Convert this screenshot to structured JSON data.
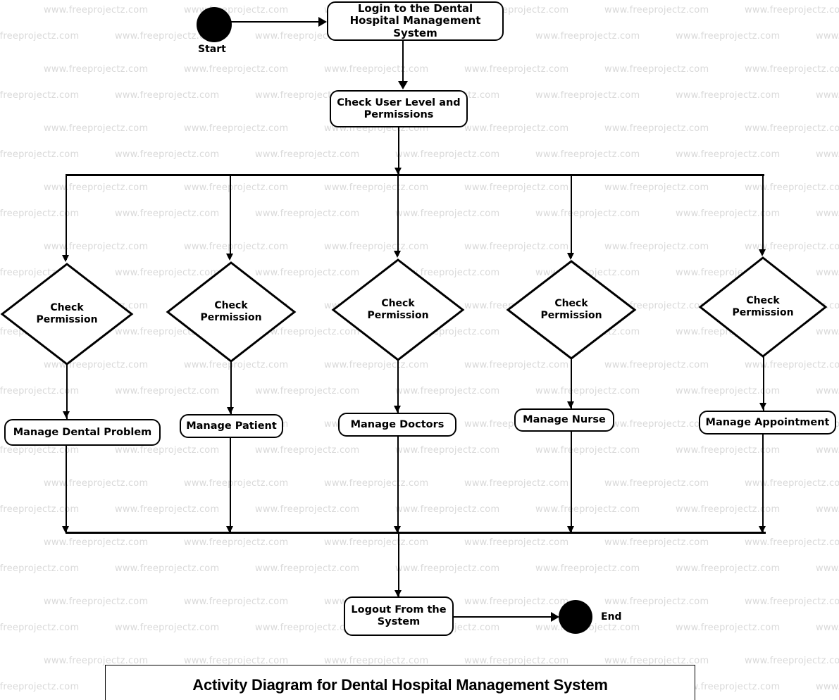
{
  "diagram": {
    "title": "Activity Diagram for Dental Hospital Management System",
    "watermark_text": "www.freeprojectz.com",
    "stroke_color": "#000000",
    "background_color": "#ffffff",
    "watermark_color": "#d9d9d9"
  },
  "nodes": {
    "start": {
      "label": "Start",
      "type": "initial-node"
    },
    "login": {
      "label": "Login to the Dental Hospital Management System",
      "type": "action"
    },
    "check_user_level": {
      "label": "Check User Level and Permissions",
      "type": "action"
    },
    "logout": {
      "label": "Logout From the System",
      "type": "action"
    },
    "end": {
      "label": "End",
      "type": "final-node"
    }
  },
  "branches": [
    {
      "decision": "Check\nPermission",
      "action": "Manage Dental Problem"
    },
    {
      "decision": "Check\nPermission",
      "action": "Manage Patient"
    },
    {
      "decision": "Check\nPermission",
      "action": "Manage Doctors"
    },
    {
      "decision": "Check\nPermission",
      "action": "Manage Nurse"
    },
    {
      "decision": "Check\nPermission",
      "action": "Manage Appointment"
    }
  ]
}
